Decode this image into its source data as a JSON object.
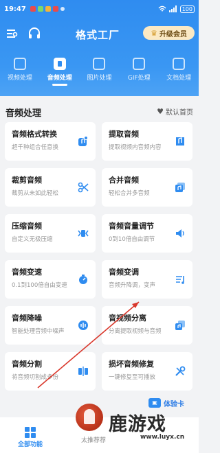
{
  "status_bar": {
    "time": "19:47",
    "battery": "100"
  },
  "header": {
    "title": "格式工厂",
    "vip_label": "升级会员"
  },
  "tabs": [
    {
      "label": "视频处理",
      "active": false
    },
    {
      "label": "音频处理",
      "active": true
    },
    {
      "label": "图片处理",
      "active": false
    },
    {
      "label": "GIF处理",
      "active": false
    },
    {
      "label": "文档处理",
      "active": false
    }
  ],
  "section": {
    "title": "音频处理",
    "default_home": "默认首页"
  },
  "cards": [
    {
      "name": "音频格式转换",
      "desc": "超千种组合任意换",
      "icon": "audio-convert-icon"
    },
    {
      "name": "提取音频",
      "desc": "提取视频内音频内容",
      "icon": "extract-audio-icon"
    },
    {
      "name": "裁剪音频",
      "desc": "裁剪从未如此轻松",
      "icon": "scissors-icon"
    },
    {
      "name": "合并音频",
      "desc": "轻松合并多音频",
      "icon": "merge-audio-icon"
    },
    {
      "name": "压缩音频",
      "desc": "自定义无极压缩",
      "icon": "compress-audio-icon"
    },
    {
      "name": "音频音量调节",
      "desc": "0到10倍自由调节",
      "icon": "volume-icon"
    },
    {
      "name": "音频变速",
      "desc": "0.1到100倍自由变速",
      "icon": "speed-icon"
    },
    {
      "name": "音频变调",
      "desc": "音频升降调，变声",
      "icon": "pitch-icon"
    },
    {
      "name": "音频降噪",
      "desc": "智能处理音频中噪声",
      "icon": "denoise-icon"
    },
    {
      "name": "音视频分离",
      "desc": "分离提取视频与音频",
      "icon": "separate-icon"
    },
    {
      "name": "音频分割",
      "desc": "将音频切割成多份",
      "icon": "split-audio-icon"
    },
    {
      "name": "损坏音频修复",
      "desc": "一键修复至可播放",
      "icon": "repair-icon"
    }
  ],
  "trial_card": "体验卡",
  "bottom_nav": {
    "all": "全部功能",
    "recommend": "太推荐荐"
  },
  "watermark": {
    "text": "鹿游戏",
    "url": "www.luyx.cn"
  },
  "colors": {
    "primary": "#2f8cf0",
    "vip_bg": "#fbe9c4"
  }
}
